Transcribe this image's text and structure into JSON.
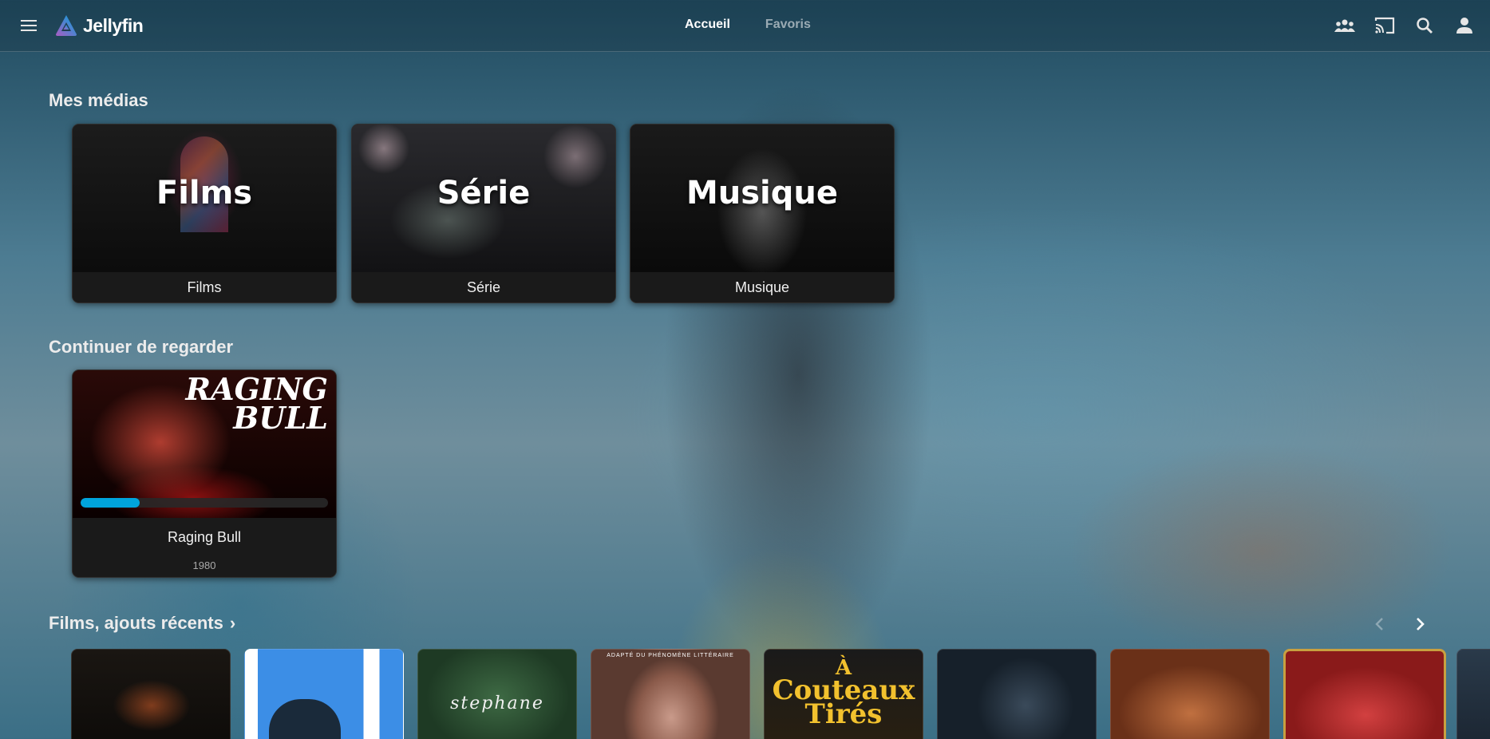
{
  "header": {
    "app_name": "Jellyfin",
    "tabs": [
      {
        "label": "Accueil",
        "active": true
      },
      {
        "label": "Favoris",
        "active": false
      }
    ],
    "icons": [
      "menu-icon",
      "sync-play-icon",
      "cast-icon",
      "search-icon",
      "user-icon"
    ]
  },
  "my_media": {
    "title": "Mes médias",
    "items": [
      {
        "overlay": "Films",
        "label": "Films"
      },
      {
        "overlay": "Série",
        "label": "Série"
      },
      {
        "overlay": "Musique",
        "label": "Musique"
      }
    ]
  },
  "continue_watching": {
    "title": "Continuer de regarder",
    "items": [
      {
        "art_line1": "RAGING",
        "art_line2": "BULL",
        "title": "Raging Bull",
        "year": "1980",
        "progress": 0.24
      }
    ]
  },
  "recent_movies": {
    "title": "Films, ajouts récents",
    "chevron": "›",
    "posters": [
      {
        "name": "poster-1"
      },
      {
        "name": "poster-2"
      },
      {
        "name": "poster-3",
        "text": "stephane"
      },
      {
        "name": "poster-4",
        "text": "ADAPTÉ DU PHÉNOMÈNE LITTÉRAIRE"
      },
      {
        "name": "poster-5",
        "text1": "À",
        "text2": "Couteaux",
        "text3": "Tirés"
      },
      {
        "name": "poster-6"
      },
      {
        "name": "poster-7"
      },
      {
        "name": "poster-8"
      }
    ]
  },
  "colors": {
    "accent": "#00a4dc",
    "card_bg": "#141414",
    "text": "#ffffff"
  }
}
